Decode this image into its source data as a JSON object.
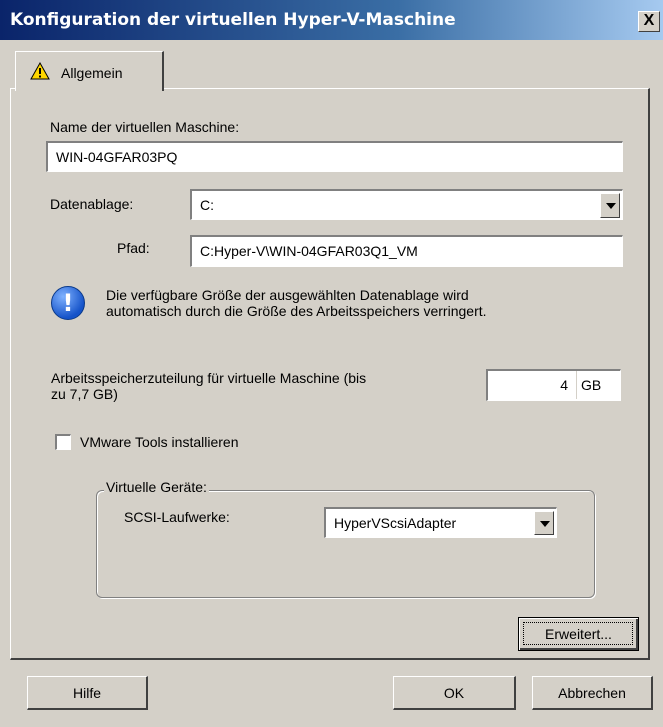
{
  "window": {
    "title": "Konfiguration der virtuellen Hyper-V-Maschine",
    "close_label": "X"
  },
  "tab": {
    "label": "Allgemein",
    "icon": "warning-icon"
  },
  "form": {
    "vm_name_label": "Name der virtuellen Maschine:",
    "vm_name_value": "WIN-04GFAR03PQ",
    "datastore_label": "Datenablage:",
    "datastore_value": "C:",
    "path_label": "Pfad:",
    "path_value": "C:Hyper-V\\WIN-04GFAR03Q1_VM",
    "info_text_line1": "Die verfügbare Größe der ausgewählten Datenablage wird",
    "info_text_line2": "automatisch durch die Größe des Arbeitsspeichers verringert.",
    "memory_label_line1": "Arbeitsspeicherzuteilung für virtuelle Maschine (bis",
    "memory_label_line2": "zu 7,7 GB)",
    "memory_value": "4",
    "memory_unit": "GB",
    "vmware_tools_label": "VMware Tools installieren",
    "vmware_tools_checked": false
  },
  "devices": {
    "group_label": "Virtuelle Geräte:",
    "scsi_label": "SCSI-Laufwerke:",
    "scsi_value": "HyperVScsiAdapter"
  },
  "buttons": {
    "advanced": "Erweitert...",
    "help": "Hilfe",
    "ok": "OK",
    "cancel": "Abbrechen"
  }
}
